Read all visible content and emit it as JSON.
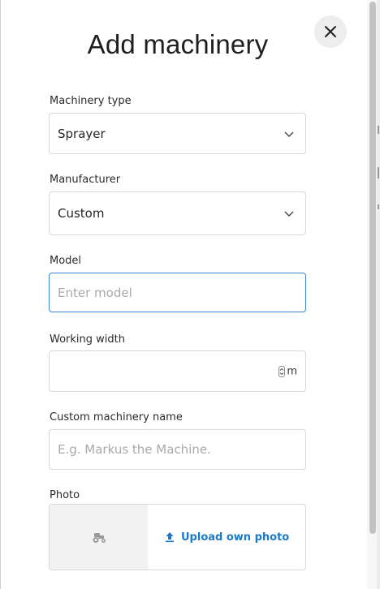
{
  "dialog": {
    "title": "Add machinery"
  },
  "fields": {
    "machinery_type": {
      "label": "Machinery type",
      "value": "Sprayer"
    },
    "manufacturer": {
      "label": "Manufacturer",
      "value": "Custom"
    },
    "model": {
      "label": "Model",
      "placeholder": "Enter model",
      "value": ""
    },
    "working_width": {
      "label": "Working width",
      "value": "",
      "unit": "m"
    },
    "custom_name": {
      "label": "Custom machinery name",
      "placeholder": "E.g. Markus the Machine.",
      "value": ""
    },
    "photo": {
      "label": "Photo",
      "upload_label": "Upload own photo"
    }
  },
  "icons": {
    "close": "close-icon",
    "dropdown": "chevron-down-icon",
    "stepper": "stepper-icon",
    "photo_placeholder": "tractor-icon",
    "upload": "upload-icon"
  },
  "colors": {
    "accent": "#1d79c4",
    "focus_border": "#3a86c8",
    "field_border": "#d8d8d8",
    "placeholder": "#a9a9a9"
  }
}
